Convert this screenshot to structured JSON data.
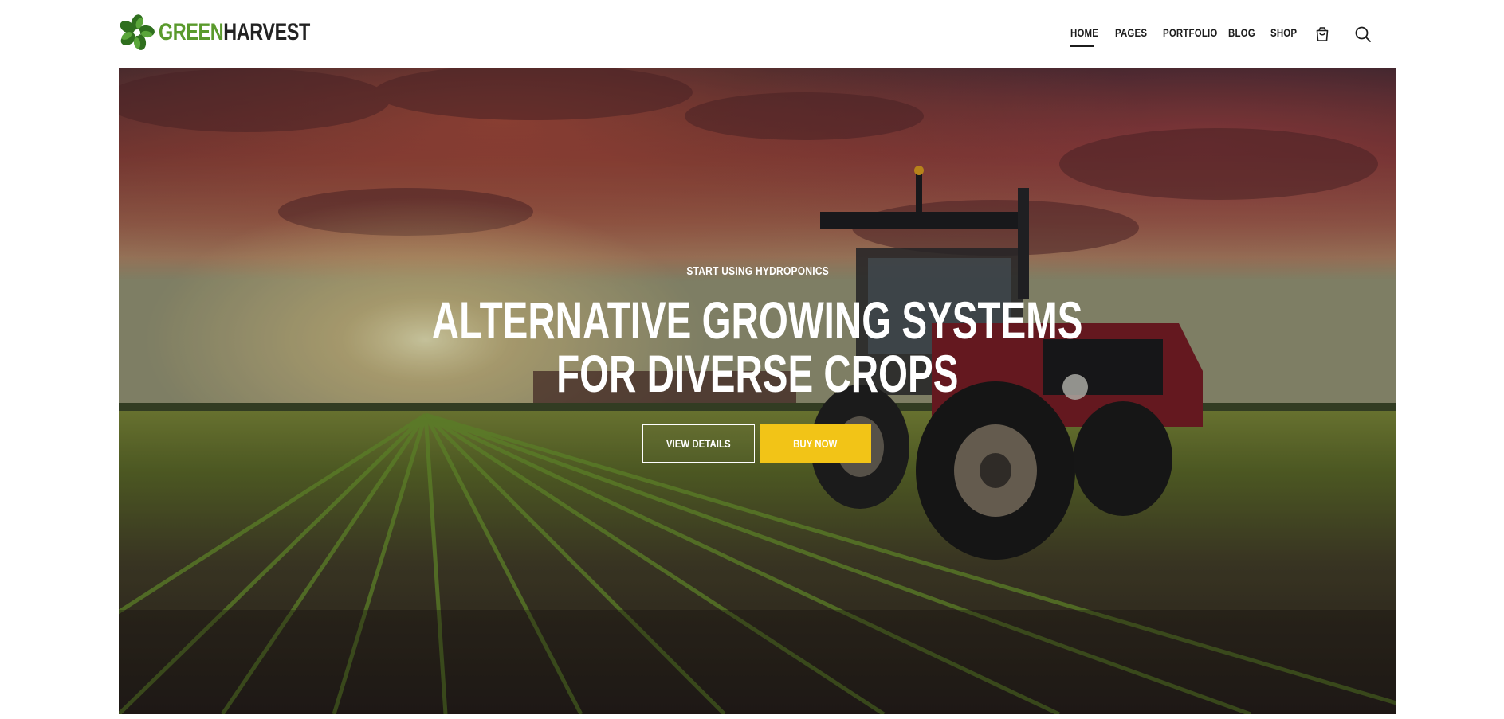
{
  "brand": {
    "name_part1": "GREEN",
    "name_part2": "HARVEST",
    "logo_icon": "clover-leaf-icon",
    "color_green": "#5a9a2c",
    "color_dark": "#222222"
  },
  "nav": {
    "items": [
      {
        "label": "HOME",
        "active": true
      },
      {
        "label": "PAGES",
        "active": false
      },
      {
        "label": "PORTFOLIO",
        "active": false
      },
      {
        "label": "BLOG",
        "active": false
      },
      {
        "label": "SHOP",
        "active": false
      }
    ],
    "cart_icon": "shopping-bag-icon",
    "search_icon": "search-icon"
  },
  "hero": {
    "eyebrow": "START USING HYDROPONICS",
    "headline_line1": "ALTERNATIVE GROWING SYSTEMS",
    "headline_line2": "FOR DIVERSE CROPS",
    "primary_button": "VIEW DETAILS",
    "secondary_button": "BUY NOW",
    "accent_color": "#f2c417",
    "background_image": "tractor in a crop field at sunset"
  }
}
